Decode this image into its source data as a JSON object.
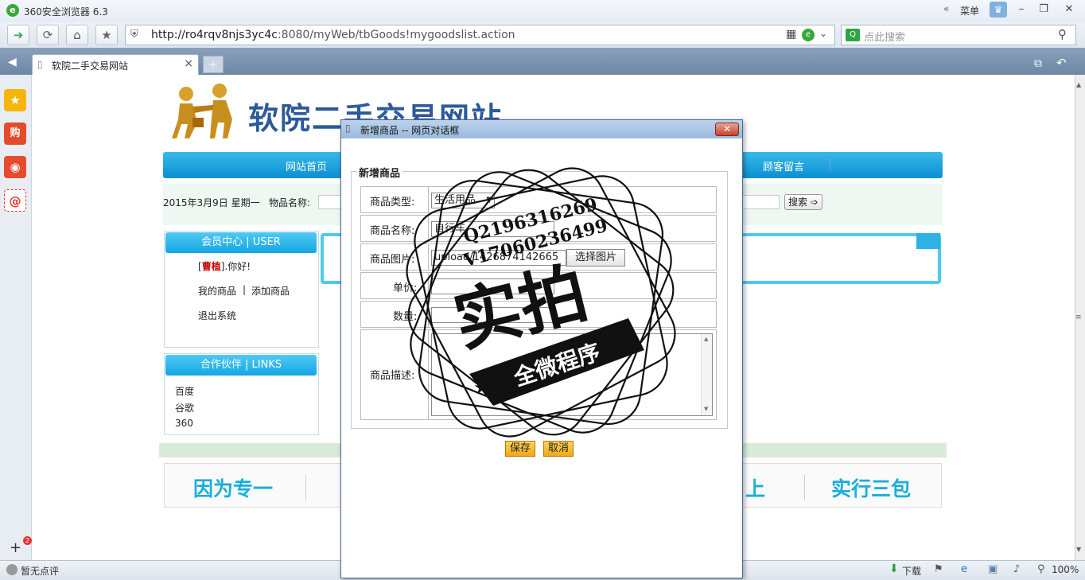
{
  "browser": {
    "title": "360安全浏览器 6.3",
    "menu_label": "菜单",
    "url_host": "http://ro4rqv8njs3yc4c",
    "url_rest": ":8080/myWeb/tbGoods!mygoodslist.action",
    "search_placeholder": "点此搜索",
    "tab_label": "软院二手交易网站",
    "status_left": "暂无点评",
    "download_label": "下载",
    "zoom_label": "100%",
    "sidebar_badge": "2"
  },
  "site": {
    "title": "软院二手交易网站",
    "menu": [
      "网站首页",
      "顾客留言"
    ],
    "date": "2015年3月9日  星期一",
    "search_label": "物品名称:",
    "search_button": "搜索",
    "member_head": "会员中心 | USER",
    "user_name": "曹植",
    "greeting": "].你好!",
    "my_goods": "我的商品",
    "add_goods": "添加商品",
    "logout": "退出系统",
    "links_head": "合作伙伴 | LINKS",
    "links": [
      "百度",
      "谷歌",
      "360"
    ],
    "footer_left": "因为专一",
    "footer_mid": "上",
    "footer_right": "实行三包"
  },
  "dialog": {
    "title": "新增商品 -- 网页对话框",
    "legend": "新增商品",
    "type_label": "商品类型:",
    "type_value": "生活用品",
    "name_label": "商品名称:",
    "name_value": "自行车",
    "image_label": "商品图片:",
    "image_value": "upload/1426874142665",
    "choose_image": "选择图片",
    "price_label": "单价:",
    "qty_label": "数量:",
    "desc_label": "商品描述:",
    "save_label": "保存",
    "cancel_label": "取消"
  },
  "watermark": {
    "line1": "Q2196316269",
    "line2": "V17060236499",
    "big": "实拍",
    "banner": "全微程序"
  }
}
